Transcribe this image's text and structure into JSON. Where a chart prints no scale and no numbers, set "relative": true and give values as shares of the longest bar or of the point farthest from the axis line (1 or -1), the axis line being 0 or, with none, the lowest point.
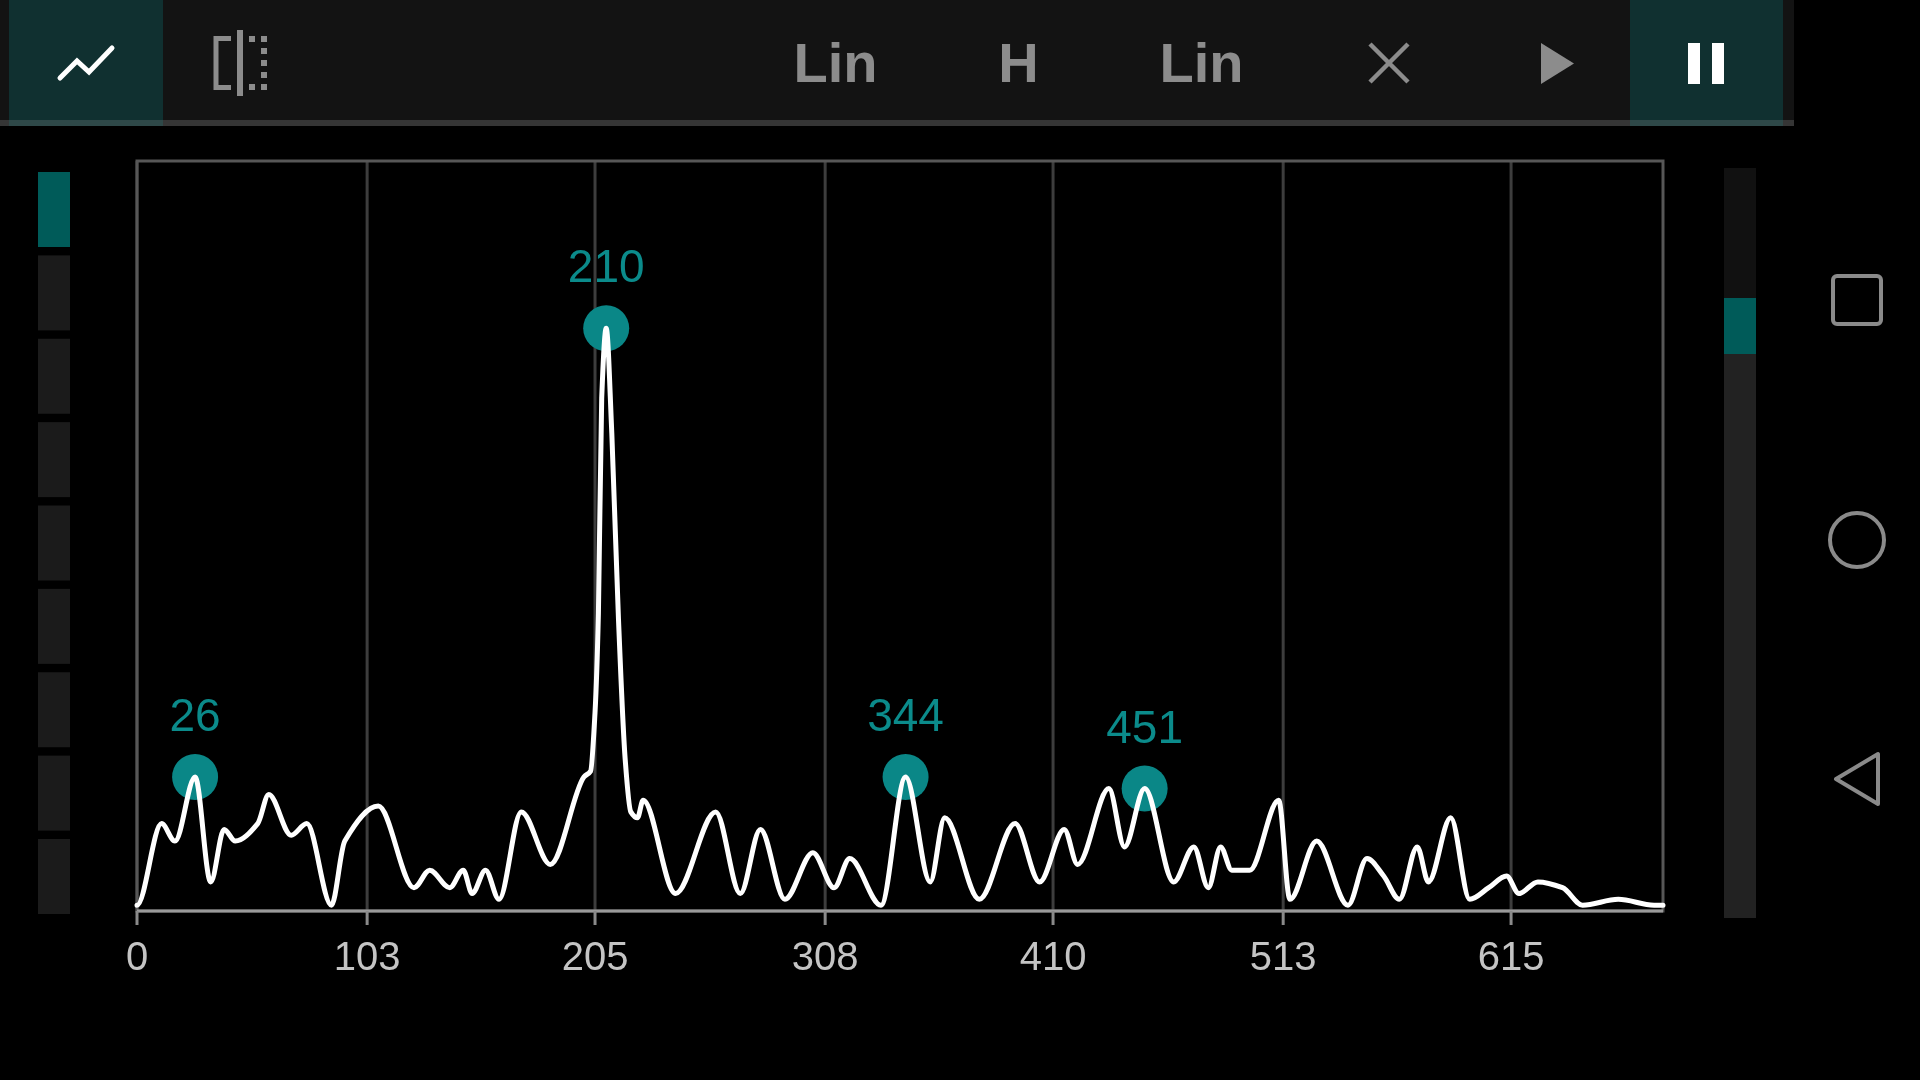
{
  "toolbar": {
    "left": [
      {
        "kind": "graph",
        "selected": true
      },
      {
        "kind": "split",
        "selected": false
      }
    ],
    "right": [
      {
        "kind": "text",
        "label": "Lin",
        "selected": false
      },
      {
        "kind": "text",
        "label": "H",
        "selected": false
      },
      {
        "kind": "text",
        "label": "Lin",
        "selected": false
      },
      {
        "kind": "clear",
        "selected": false
      },
      {
        "kind": "play",
        "selected": false
      },
      {
        "kind": "pause",
        "selected": true
      }
    ]
  },
  "level_meter": {
    "level": 0.11
  },
  "spectrum": {
    "chart_data": {
      "type": "line",
      "relative": true,
      "grid": true,
      "xlim": [
        0,
        683
      ],
      "xticks": [
        0,
        103,
        205,
        308,
        410,
        513,
        615
      ],
      "x": [
        0,
        11,
        17,
        26,
        33,
        39,
        44,
        54,
        59,
        69,
        76,
        87,
        93,
        108,
        124,
        131,
        140,
        146,
        150,
        156,
        162,
        172,
        185,
        200,
        203,
        205,
        206.5,
        208,
        210,
        212.5,
        215.5,
        218.5,
        221,
        224,
        226.5,
        241,
        259,
        270,
        279,
        290,
        302.5,
        312,
        319,
        333,
        344,
        355,
        361.5,
        377,
        393,
        404,
        415,
        421,
        435,
        442,
        451,
        464,
        473,
        479.5,
        485,
        490,
        498,
        511,
        516,
        528,
        542,
        550.5,
        558,
        565,
        573,
        578,
        588,
        596.5,
        605,
        613,
        618.5,
        627,
        638,
        647,
        663,
        679,
        683
      ],
      "values": [
        0.01,
        0.15,
        0.12,
        0.23,
        0.05,
        0.14,
        0.12,
        0.15,
        0.2,
        0.13,
        0.15,
        0.01,
        0.12,
        0.18,
        0.04,
        0.07,
        0.04,
        0.07,
        0.03,
        0.07,
        0.02,
        0.17,
        0.08,
        0.23,
        0.24,
        0.34,
        0.51,
        0.88,
        1,
        0.82,
        0.5,
        0.26,
        0.17,
        0.16,
        0.19,
        0.03,
        0.17,
        0.03,
        0.14,
        0.02,
        0.1,
        0.04,
        0.09,
        0.01,
        0.23,
        0.05,
        0.16,
        0.02,
        0.15,
        0.05,
        0.14,
        0.08,
        0.21,
        0.11,
        0.21,
        0.05,
        0.11,
        0.04,
        0.11,
        0.07,
        0.07,
        0.19,
        0.02,
        0.12,
        0.01,
        0.09,
        0.06,
        0.02,
        0.11,
        0.05,
        0.16,
        0.02,
        0.04,
        0.06,
        0.03,
        0.05,
        0.04,
        0.01,
        0.02,
        0.01,
        0.01
      ],
      "annotations": [
        "26",
        "210",
        "344",
        "451"
      ]
    }
  }
}
